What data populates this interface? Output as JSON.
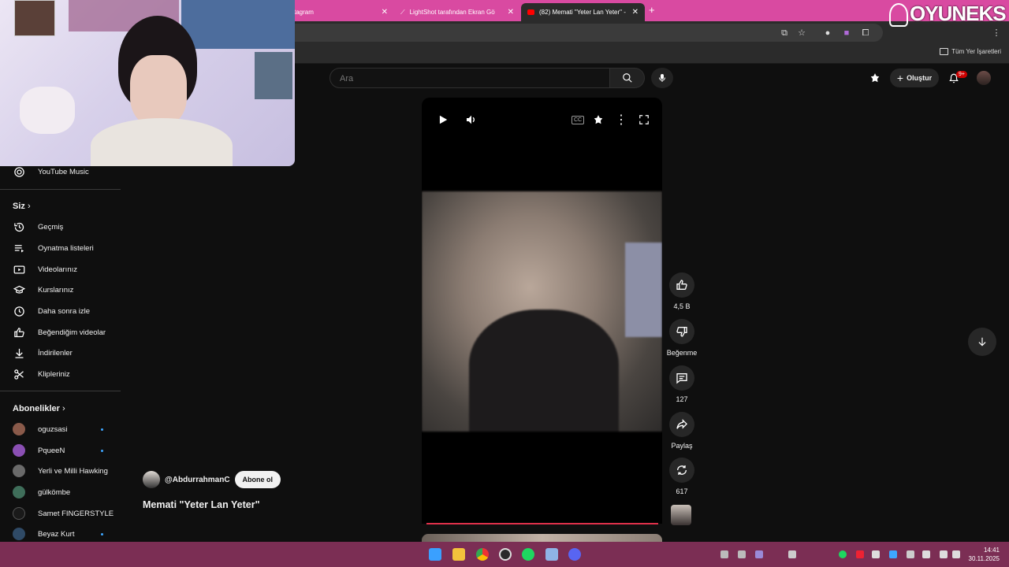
{
  "browser": {
    "tabs": [
      {
        "label": "tagram"
      },
      {
        "label": "LightShot tarafından Ekran Gö"
      },
      {
        "label": "(82) Memati \"Yeter Lan Yeter\" -"
      }
    ],
    "bookmarks_all": "Tüm Yer İşaretleri"
  },
  "overlay": {
    "logo": "OYUNEKS"
  },
  "youtube": {
    "search_placeholder": "Ara",
    "create_label": "Oluştur",
    "notif_badge": "9+",
    "sidebar": {
      "music": "YouTube Music",
      "you_header": "Siz",
      "you_items": [
        {
          "label": "Geçmiş",
          "icon": "history-icon"
        },
        {
          "label": "Oynatma listeleri",
          "icon": "playlist-icon"
        },
        {
          "label": "Videolarınız",
          "icon": "your-videos-icon"
        },
        {
          "label": "Kurslarınız",
          "icon": "courses-icon"
        },
        {
          "label": "Daha sonra izle",
          "icon": "watch-later-icon"
        },
        {
          "label": "Beğendiğim videolar",
          "icon": "liked-icon"
        },
        {
          "label": "İndirilenler",
          "icon": "download-icon"
        },
        {
          "label": "Klipleriniz",
          "icon": "clips-icon"
        }
      ],
      "subs_header": "Abonelikler",
      "subscriptions": [
        {
          "name": "oguzsasi",
          "color": "#8a5a4a",
          "new": true
        },
        {
          "name": "PqueeN",
          "color": "#8a4fb3",
          "new": true
        },
        {
          "name": "Yerli ve Milli Hawking",
          "color": "#6a6a6a",
          "new": false
        },
        {
          "name": "gülkömbe",
          "color": "#3f6e5a",
          "new": false
        },
        {
          "name": "Samet FINGERSTYLE",
          "color": "#1a1a1a",
          "new": false
        },
        {
          "name": "Beyaz Kurt",
          "color": "#2f4a66",
          "new": true
        }
      ]
    },
    "short": {
      "channel": "@AbdurrahmanC",
      "subscribe": "Abone ol",
      "title": "Memati \"Yeter Lan Yeter\"",
      "likes": "4,5 B",
      "dislike": "Beğenme",
      "comments": "127",
      "share": "Paylaş",
      "remix": "617"
    }
  },
  "taskbar": {
    "time": "14:41",
    "date": "30.11.2025"
  }
}
